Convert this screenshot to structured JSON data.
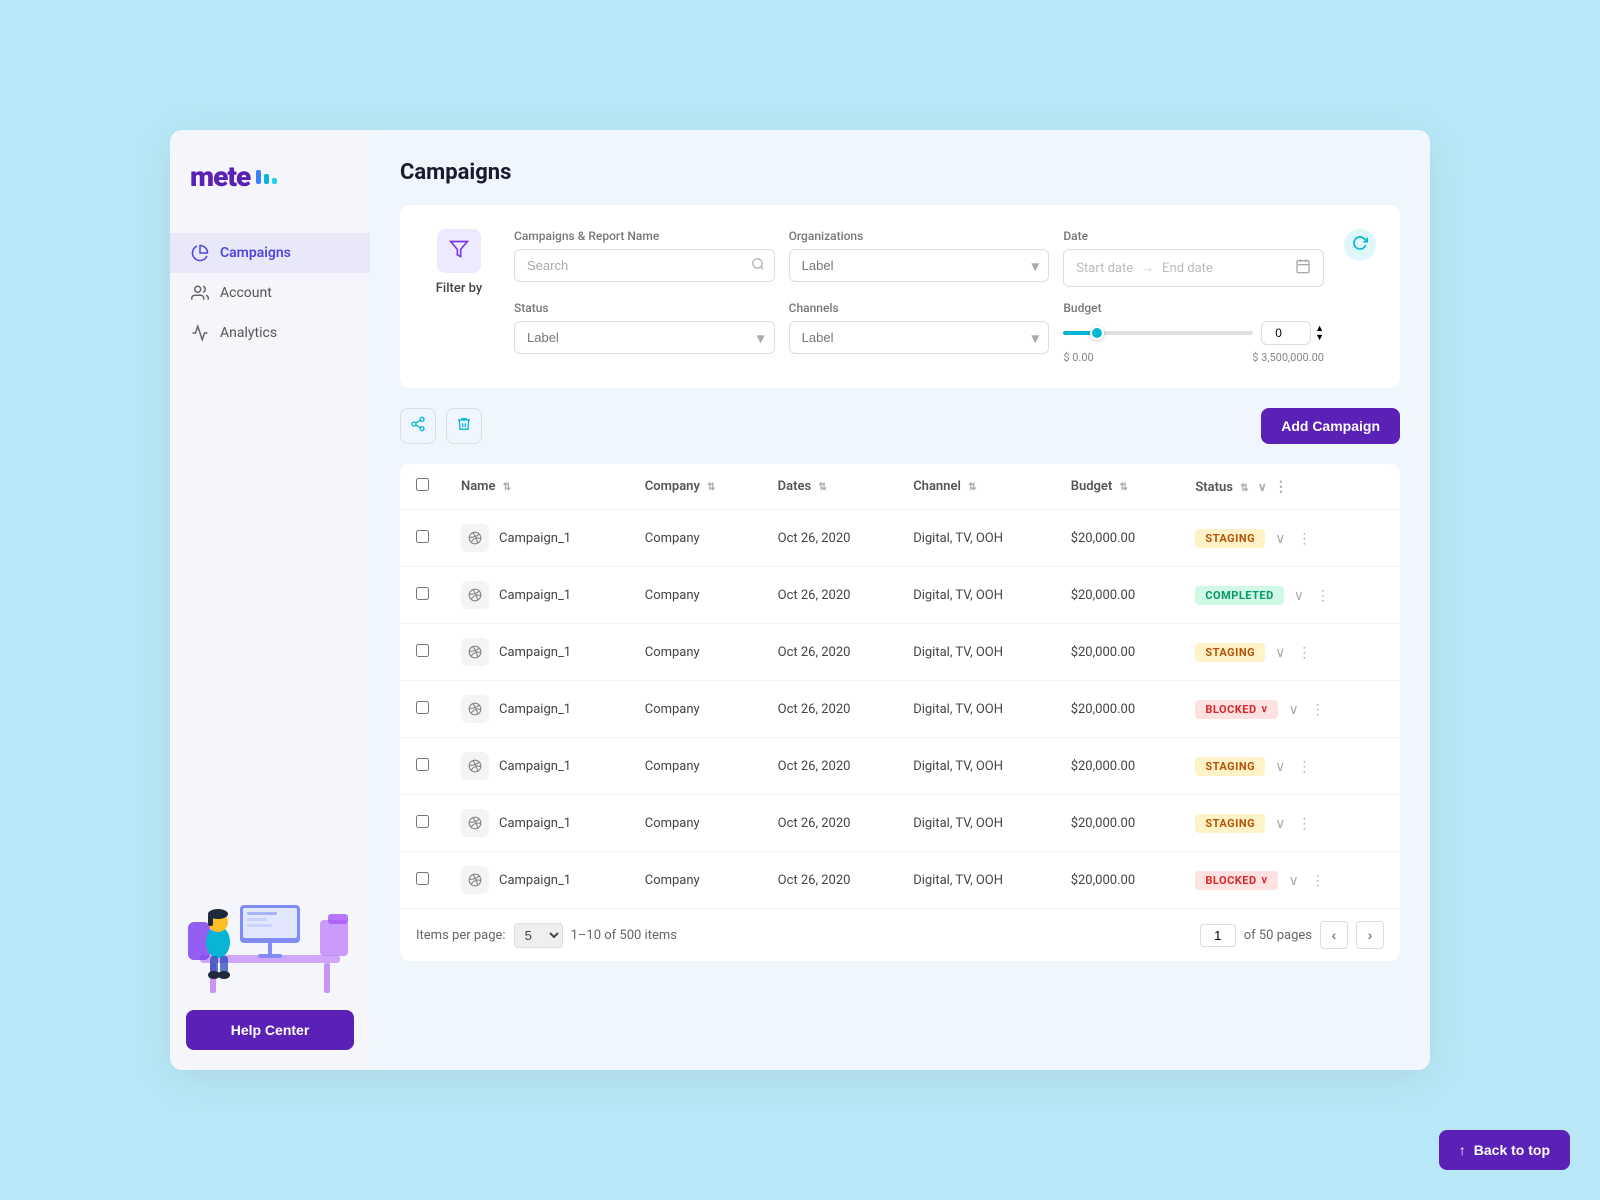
{
  "app": {
    "logo_text": "mete",
    "title": "Campaigns"
  },
  "sidebar": {
    "items": [
      {
        "id": "campaigns",
        "label": "Campaigns",
        "icon": "chart-pie-icon",
        "active": true
      },
      {
        "id": "account",
        "label": "Account",
        "icon": "users-icon",
        "active": false
      },
      {
        "id": "analytics",
        "label": "Analytics",
        "icon": "chart-line-icon",
        "active": false
      }
    ],
    "help_button_label": "Help Center"
  },
  "filter": {
    "title": "Filter by",
    "fields": {
      "campaigns_label": "Campaigns & Report Name",
      "campaigns_placeholder": "Search",
      "organizations_label": "Organizations",
      "organizations_placeholder": "Label",
      "date_label": "Date",
      "date_start_placeholder": "Start date",
      "date_end_placeholder": "End date",
      "status_label": "Status",
      "status_placeholder": "Label",
      "channels_label": "Channels",
      "channels_placeholder": "Label",
      "budget_label": "Budget",
      "budget_min": "$ 0.00",
      "budget_max": "$ 3,500,000.00",
      "budget_default": "0"
    }
  },
  "toolbar": {
    "add_button_label": "Add Campaign",
    "share_icon": "↗",
    "delete_icon": "🗑"
  },
  "table": {
    "columns": [
      {
        "id": "name",
        "label": "Name"
      },
      {
        "id": "company",
        "label": "Company"
      },
      {
        "id": "dates",
        "label": "Dates"
      },
      {
        "id": "channel",
        "label": "Channel"
      },
      {
        "id": "budget",
        "label": "Budget"
      },
      {
        "id": "status",
        "label": "Status"
      }
    ],
    "rows": [
      {
        "name": "Campaign_1",
        "company": "Company",
        "dates": "Oct 26, 2020",
        "channel": "Digital, TV, OOH",
        "budget": "$20,000.00",
        "status": "STAGING",
        "status_type": "staging"
      },
      {
        "name": "Campaign_1",
        "company": "Company",
        "dates": "Oct 26, 2020",
        "channel": "Digital, TV, OOH",
        "budget": "$20,000.00",
        "status": "COMPLETED",
        "status_type": "completed"
      },
      {
        "name": "Campaign_1",
        "company": "Company",
        "dates": "Oct 26, 2020",
        "channel": "Digital, TV, OOH",
        "budget": "$20,000.00",
        "status": "STAGING",
        "status_type": "staging"
      },
      {
        "name": "Campaign_1",
        "company": "Company",
        "dates": "Oct 26, 2020",
        "channel": "Digital, TV, OOH",
        "budget": "$20,000.00",
        "status": "BLOCKED",
        "status_type": "blocked"
      },
      {
        "name": "Campaign_1",
        "company": "Company",
        "dates": "Oct 26, 2020",
        "channel": "Digital, TV, OOH",
        "budget": "$20,000.00",
        "status": "STAGING",
        "status_type": "staging"
      },
      {
        "name": "Campaign_1",
        "company": "Company",
        "dates": "Oct 26, 2020",
        "channel": "Digital, TV, OOH",
        "budget": "$20,000.00",
        "status": "STAGING",
        "status_type": "staging"
      },
      {
        "name": "Campaign_1",
        "company": "Company",
        "dates": "Oct 26, 2020",
        "channel": "Digital, TV, OOH",
        "budget": "$20,000.00",
        "status": "BLOCKED",
        "status_type": "blocked"
      }
    ]
  },
  "pagination": {
    "items_per_page_label": "Items per page:",
    "items_per_page_value": "5",
    "range_label": "1–10 of 500 items",
    "current_page": "1",
    "total_pages_label": "of 50 pages"
  },
  "back_to_top": {
    "label": "Back to top"
  }
}
